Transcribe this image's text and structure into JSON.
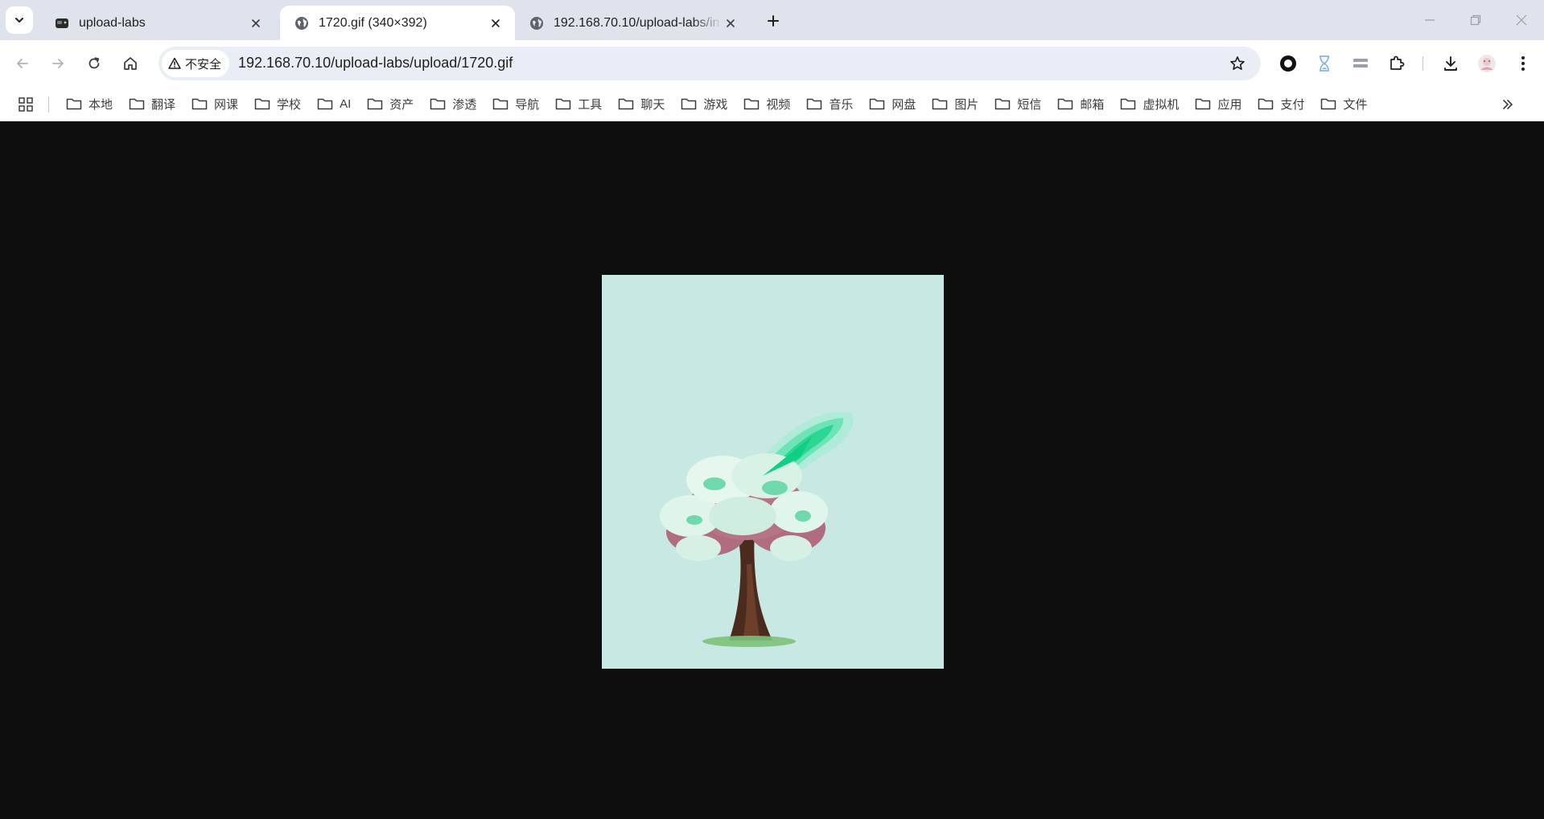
{
  "tabs": [
    {
      "title": "upload-labs",
      "icon": "game-controller-icon",
      "active": false
    },
    {
      "title": "1720.gif (340×392)",
      "icon": "globe-icon",
      "active": true
    },
    {
      "title": "192.168.70.10/upload-labs/in",
      "icon": "globe-icon",
      "active": false
    }
  ],
  "toolbar": {
    "security_label": "不安全",
    "url": "192.168.70.10/upload-labs/upload/1720.gif"
  },
  "bookmarks": [
    "本地",
    "翻译",
    "网课",
    "学校",
    "AI",
    "资产",
    "渗透",
    "导航",
    "工具",
    "聊天",
    "游戏",
    "视频",
    "音乐",
    "网盘",
    "图片",
    "短信",
    "邮箱",
    "虚拟机",
    "应用",
    "支付",
    "文件"
  ],
  "image": {
    "description_icon": "tree-with-green-energy-image",
    "background_color": "#c8e8e3"
  },
  "colors": {
    "tabstrip_bg": "#dfe3eb",
    "toolbar_bg": "#ffffff",
    "omnibox_bg": "#e9edf5",
    "viewer_bg": "#0e0e0e"
  }
}
